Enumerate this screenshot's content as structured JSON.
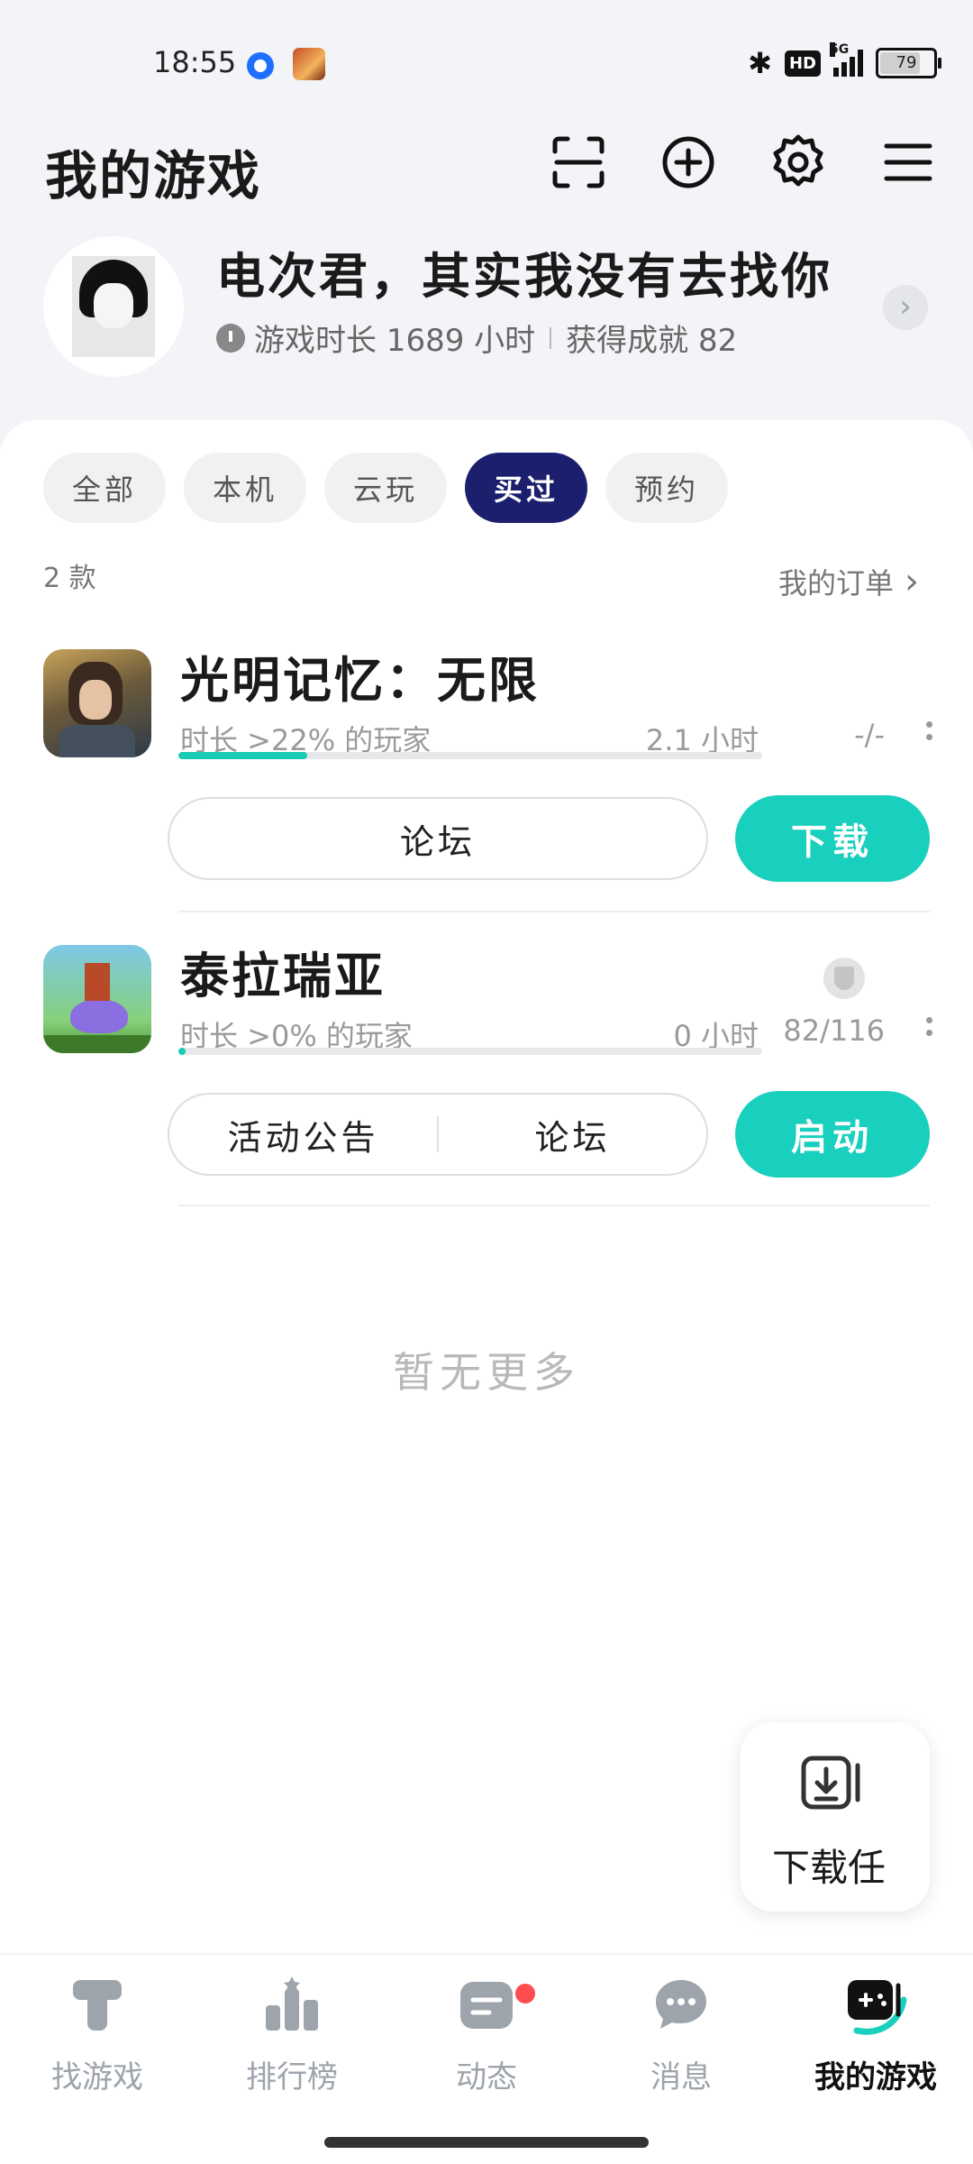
{
  "status": {
    "time": "18:55",
    "hd": "HD",
    "network": "5G",
    "battery": "79",
    "battery_level": 0.79
  },
  "header": {
    "title": "我的游戏"
  },
  "profile": {
    "name": "电次君，其实我没有去找你",
    "playtime": "游戏时长 1689 小时",
    "achievements": "获得成就 82"
  },
  "filters": [
    {
      "label": "全部",
      "active": false
    },
    {
      "label": "本机",
      "active": false
    },
    {
      "label": "云玩",
      "active": false
    },
    {
      "label": "买过",
      "active": true
    },
    {
      "label": "预约",
      "active": false
    }
  ],
  "list": {
    "count": "2 款",
    "orders_label": "我的订单"
  },
  "games": [
    {
      "title": "光明记忆：无限",
      "meta": "时长 >22% 的玩家",
      "hours": "2.1 小时",
      "achievements": "-/-",
      "progress": 0.22,
      "secondary_buttons": [
        "论坛"
      ],
      "primary_button": "下载"
    },
    {
      "title": "泰拉瑞亚",
      "meta": "时长 >0% 的玩家",
      "hours": "0 小时",
      "achievements": "82/116",
      "progress": 0.0,
      "secondary_buttons": [
        "活动公告",
        "论坛"
      ],
      "primary_button": "启动"
    }
  ],
  "no_more": "暂无更多",
  "download_task": {
    "label": "下载任"
  },
  "tabs": [
    {
      "label": "找游戏",
      "icon": "find-game-icon",
      "active": false
    },
    {
      "label": "排行榜",
      "icon": "ranking-icon",
      "active": false
    },
    {
      "label": "动态",
      "icon": "feed-icon",
      "active": false,
      "badge": true
    },
    {
      "label": "消息",
      "icon": "message-icon",
      "active": false
    },
    {
      "label": "我的游戏",
      "icon": "my-games-icon",
      "active": true
    }
  ],
  "colors": {
    "accent": "#19cfbd",
    "active_chip": "#1b1f6e",
    "badge": "#ff4d4f"
  }
}
